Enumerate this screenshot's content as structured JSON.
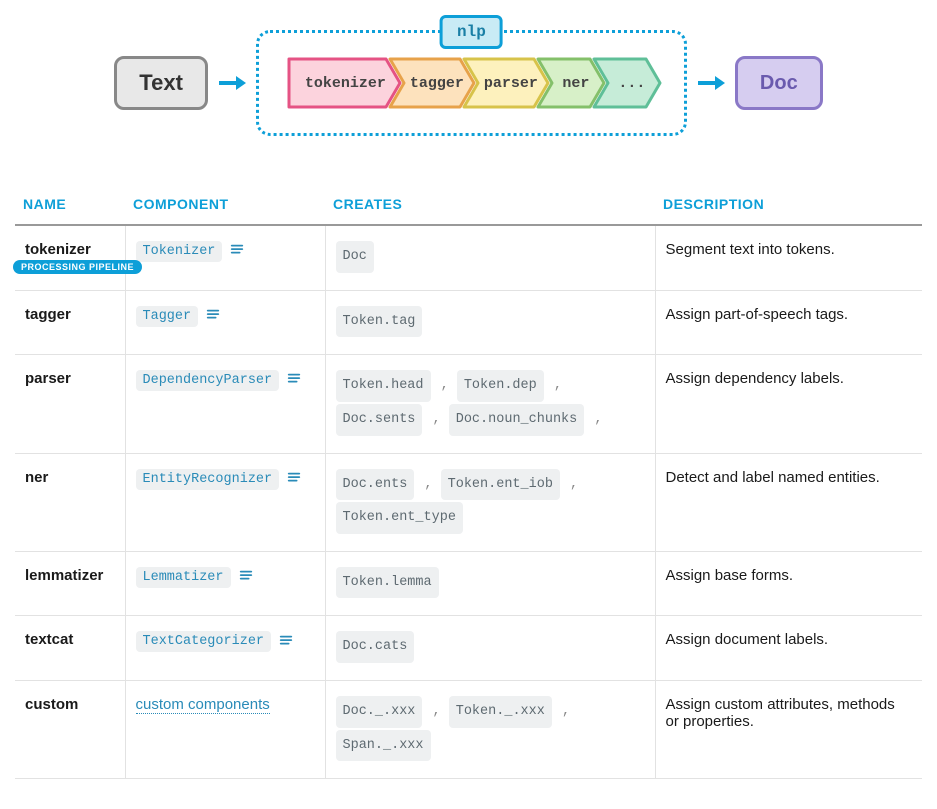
{
  "diagram": {
    "input_label": "Text",
    "group_label": "nlp",
    "output_label": "Doc",
    "stages": [
      "tokenizer",
      "tagger",
      "parser",
      "ner",
      "..."
    ],
    "stage_colors": [
      {
        "fill": "#fcd3dd",
        "stroke": "#e55384"
      },
      {
        "fill": "#fde2bd",
        "stroke": "#e7a24a"
      },
      {
        "fill": "#fdf1bd",
        "stroke": "#d7c34a"
      },
      {
        "fill": "#d7f0c8",
        "stroke": "#84c06a"
      },
      {
        "fill": "#c6ecd8",
        "stroke": "#5fbf98"
      }
    ]
  },
  "columns": [
    "NAME",
    "COMPONENT",
    "CREATES",
    "DESCRIPTION"
  ],
  "badge": "PROCESSING PIPELINE",
  "rows": [
    {
      "name": "tokenizer",
      "component": {
        "label": "Tokenizer",
        "kind": "code-link",
        "doc_icon": true
      },
      "creates": [
        "Doc"
      ],
      "description": "Segment text into tokens.",
      "badge": true
    },
    {
      "name": "tagger",
      "component": {
        "label": "Tagger",
        "kind": "code-link",
        "doc_icon": true
      },
      "creates": [
        "Token.tag"
      ],
      "description": "Assign part-of-speech tags."
    },
    {
      "name": "parser",
      "component": {
        "label": "DependencyParser",
        "kind": "code-link",
        "doc_icon": true
      },
      "creates": [
        "Token.head",
        "Token.dep",
        "Doc.sents",
        "Doc.noun_chunks"
      ],
      "description": "Assign dependency labels."
    },
    {
      "name": "ner",
      "component": {
        "label": "EntityRecognizer",
        "kind": "code-link",
        "doc_icon": true
      },
      "creates": [
        "Doc.ents",
        "Token.ent_iob",
        "Token.ent_type"
      ],
      "description": "Detect and label named entities."
    },
    {
      "name": "lemmatizer",
      "component": {
        "label": "Lemmatizer",
        "kind": "code-link",
        "doc_icon": true
      },
      "creates": [
        "Token.lemma"
      ],
      "description": "Assign base forms."
    },
    {
      "name": "textcat",
      "component": {
        "label": "TextCategorizer",
        "kind": "code-link",
        "doc_icon": true
      },
      "creates": [
        "Doc.cats"
      ],
      "description": "Assign document labels."
    },
    {
      "name": "custom",
      "component": {
        "label": "custom components",
        "kind": "text-link",
        "doc_icon": false
      },
      "creates": [
        "Doc._.xxx",
        "Token._.xxx",
        "Span._.xxx"
      ],
      "description": "Assign custom attributes, methods or properties."
    }
  ]
}
